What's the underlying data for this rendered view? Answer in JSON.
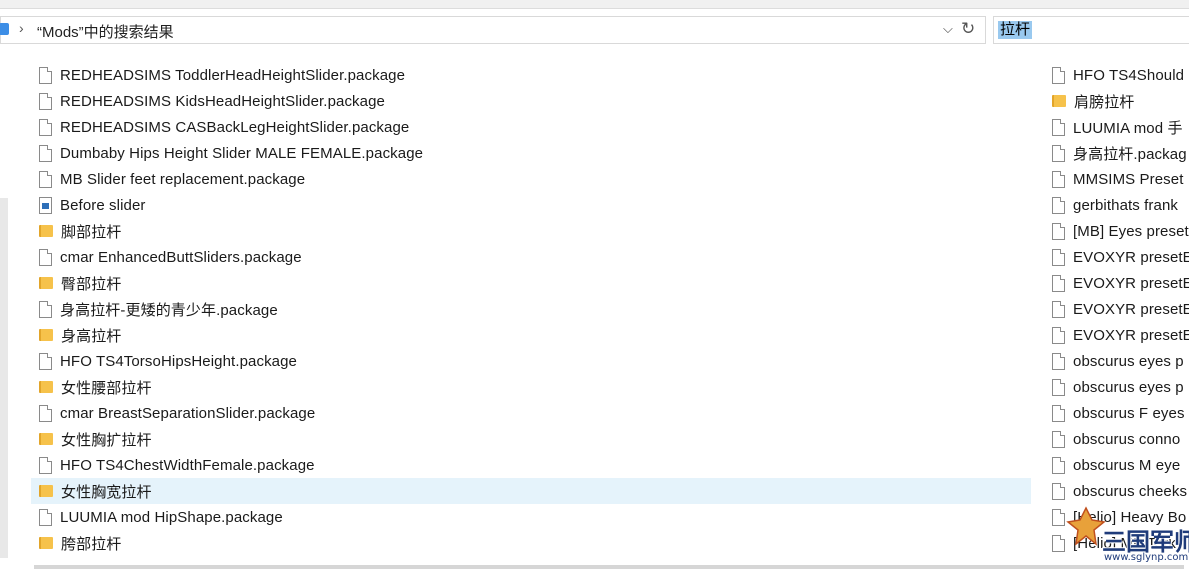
{
  "address": {
    "path_text": "“Mods”中的搜索结果"
  },
  "search": {
    "value": "拉杆"
  },
  "icons": {
    "refresh": "refresh-icon",
    "chevron": "chevron-right-icon",
    "dropdown": "chevron-down-icon"
  },
  "results_left": [
    {
      "type": "file",
      "name": "REDHEADSIMS ToddlerHeadHeightSlider.package"
    },
    {
      "type": "file",
      "name": "REDHEADSIMS KidsHeadHeightSlider.package"
    },
    {
      "type": "file",
      "name": "REDHEADSIMS CASBackLegHeightSlider.package"
    },
    {
      "type": "file",
      "name": "Dumbaby Hips Height Slider MALE FEMALE.package"
    },
    {
      "type": "file",
      "name": "MB Slider feet replacement.package"
    },
    {
      "type": "image",
      "name": "Before slider"
    },
    {
      "type": "folder",
      "name": "脚部拉杆"
    },
    {
      "type": "file",
      "name": "cmar EnhancedButtSliders.package"
    },
    {
      "type": "folder",
      "name": "臀部拉杆"
    },
    {
      "type": "file",
      "name": "身高拉杆-更矮的青少年.package"
    },
    {
      "type": "folder",
      "name": "身高拉杆"
    },
    {
      "type": "file",
      "name": "HFO TS4TorsoHipsHeight.package"
    },
    {
      "type": "folder",
      "name": "女性腰部拉杆"
    },
    {
      "type": "file",
      "name": "cmar BreastSeparationSlider.package"
    },
    {
      "type": "folder",
      "name": "女性胸扩拉杆"
    },
    {
      "type": "file",
      "name": "HFO TS4ChestWidthFemale.package"
    },
    {
      "type": "folder",
      "name": "女性胸宽拉杆",
      "selected": true
    },
    {
      "type": "file",
      "name": "LUUMIA mod HipShape.package"
    },
    {
      "type": "folder",
      "name": "胯部拉杆"
    }
  ],
  "results_right": [
    {
      "type": "file",
      "name": "HFO TS4Should"
    },
    {
      "type": "folder",
      "name": "肩膀拉杆"
    },
    {
      "type": "file",
      "name": "LUUMIA mod 手"
    },
    {
      "type": "file",
      "name": "身高拉杆.packag"
    },
    {
      "type": "file",
      "name": "MMSIMS Preset"
    },
    {
      "type": "file",
      "name": "gerbithats frank"
    },
    {
      "type": "file",
      "name": "[MB] Eyes preset"
    },
    {
      "type": "file",
      "name": "EVOXYR presetE"
    },
    {
      "type": "file",
      "name": "EVOXYR presetE"
    },
    {
      "type": "file",
      "name": "EVOXYR presetE"
    },
    {
      "type": "file",
      "name": "EVOXYR presetE"
    },
    {
      "type": "file",
      "name": "obscurus eyes p"
    },
    {
      "type": "file",
      "name": "obscurus eyes p"
    },
    {
      "type": "file",
      "name": "obscurus F eyes"
    },
    {
      "type": "file",
      "name": "obscurus conno"
    },
    {
      "type": "file",
      "name": "obscurus M eye"
    },
    {
      "type": "file",
      "name": "obscurus cheeks"
    },
    {
      "type": "file",
      "name": "[Helio] Heavy Bo"
    },
    {
      "type": "file",
      "name": "[Helio] MB Tark"
    }
  ],
  "watermark": {
    "brand": "三国军师",
    "url": "www.sglynp.com"
  }
}
